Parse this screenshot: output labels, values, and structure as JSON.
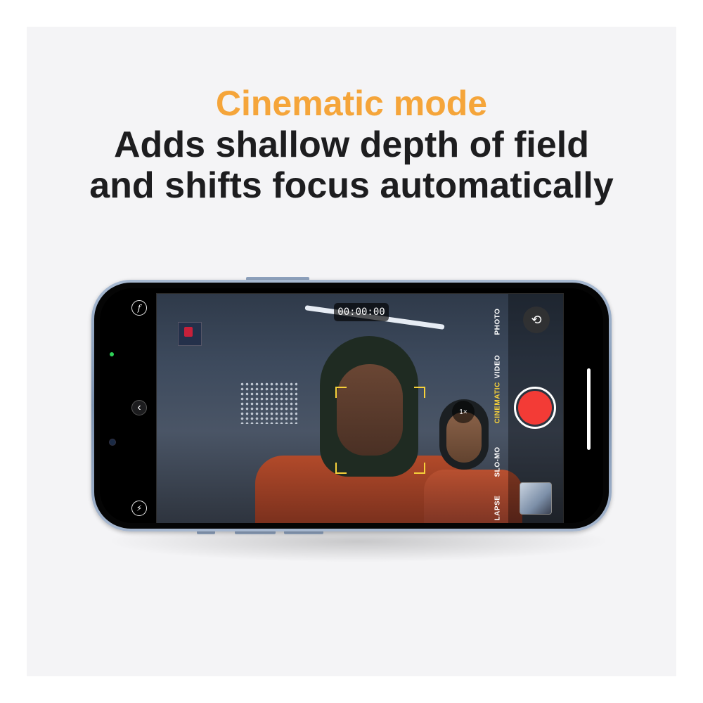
{
  "headline": {
    "eyebrow": "Cinematic mode",
    "line1": "Adds shallow depth of field",
    "line2": "and shifts focus automatically"
  },
  "colors": {
    "eyebrow": "#f5a53a",
    "shutter": "#f33b36",
    "active_mode": "#f7d13a"
  },
  "camera": {
    "timecode": "00:00:00",
    "zoom": "1×",
    "modes": [
      "PHOTO",
      "VIDEO",
      "CINEMATIC",
      "SLO-MO",
      "LAPSE"
    ],
    "active_mode": "CINEMATIC",
    "icons": {
      "aperture": "f",
      "back": "‹",
      "flash": "⚡",
      "flip": "⟲"
    }
  }
}
